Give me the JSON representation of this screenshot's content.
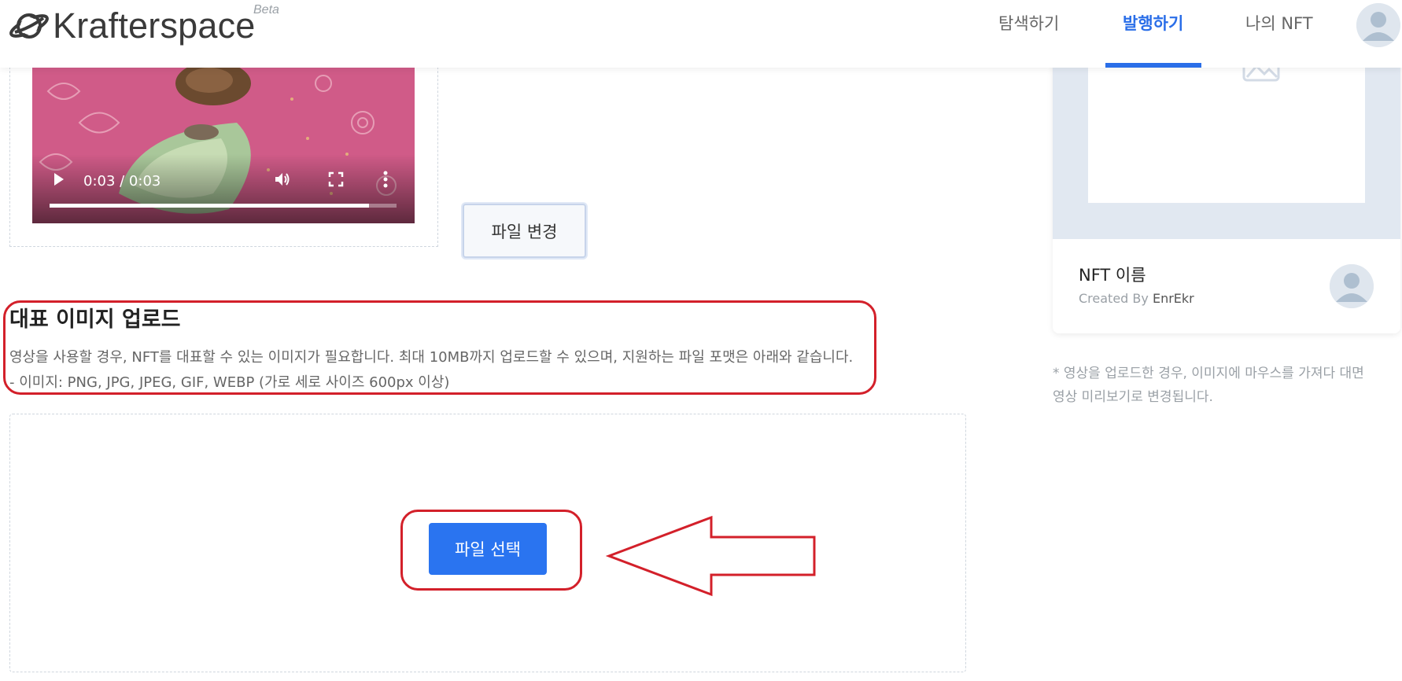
{
  "header": {
    "logo_text": "Krafterspace",
    "beta_label": "Beta",
    "nav": [
      {
        "label": "탐색하기"
      },
      {
        "label": "발행하기",
        "active": true
      },
      {
        "label": "나의 NFT"
      }
    ]
  },
  "video_upload": {
    "player": {
      "current_time": "0:03",
      "duration": "0:03",
      "time_display": "0:03 / 0:03",
      "progress": 0.92
    },
    "change_file_label": "파일 변경"
  },
  "thumbnail_upload": {
    "title": "대표 이미지 업로드",
    "description_line1": "영상을 사용할 경우, NFT를 대표할 수 있는 이미지가 필요합니다. 최대 10MB까지 업로드할 수 있으며, 지원하는 파일 포맷은 아래와 같습니다.",
    "description_line2": "- 이미지: PNG, JPG, JPEG, GIF, WEBP (가로 세로 사이즈 600px 이상)",
    "select_file_label": "파일 선택"
  },
  "preview": {
    "nft_name": "NFT 이름",
    "created_by_prefix": "Created By",
    "creator": "EnrEkr",
    "note_line1": "* 영상을 업로드한 경우, 이미지에 마우스를 가져다 대면",
    "note_line2": "영상 미리보기로 변경됩니다."
  },
  "colors": {
    "accent": "#2a6ee8",
    "button_primary": "#2a74f0",
    "annotation_red": "#d3202a",
    "preview_bg": "#e1e8f1"
  },
  "icons": [
    "planet-logo-icon",
    "play-icon",
    "volume-icon",
    "fullscreen-icon",
    "more-vertical-icon",
    "image-placeholder-icon",
    "user-avatar-icon",
    "annotation-arrow-icon"
  ]
}
